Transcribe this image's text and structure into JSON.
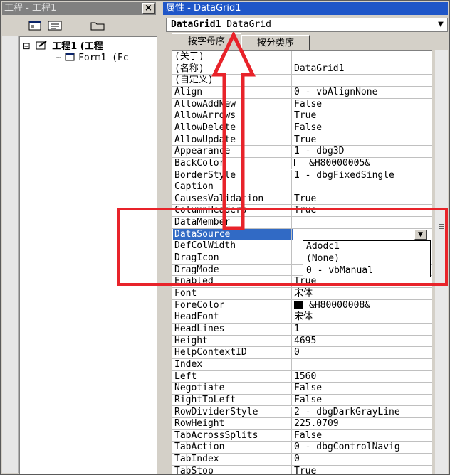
{
  "project_panel": {
    "title": "工程 - 工程1",
    "close_label": "×",
    "tree": {
      "expander": "⊟",
      "root_label": "工程1 (工程",
      "child_label": "Form1 (Fc"
    }
  },
  "properties_panel": {
    "title": "属性 - DataGrid1",
    "object_name": "DataGrid1",
    "object_type": "DataGrid",
    "tabs": [
      {
        "label": "按字母序"
      },
      {
        "label": "按分类序"
      }
    ],
    "rows": [
      {
        "name": "(关于)",
        "value": ""
      },
      {
        "name": "(名称)",
        "value": "DataGrid1"
      },
      {
        "name": "(自定义)",
        "value": ""
      },
      {
        "name": "Align",
        "value": "0 - vbAlignNone"
      },
      {
        "name": "AllowAddNew",
        "value": "False"
      },
      {
        "name": "AllowArrows",
        "value": "True"
      },
      {
        "name": "AllowDelete",
        "value": "False"
      },
      {
        "name": "AllowUpdate",
        "value": "True"
      },
      {
        "name": "Appearance",
        "value": "1 - dbg3D"
      },
      {
        "name": "BackColor",
        "value": "&H80000005&"
      },
      {
        "name": "BorderStyle",
        "value": "1 - dbgFixedSingle"
      },
      {
        "name": "Caption",
        "value": ""
      },
      {
        "name": "CausesValidation",
        "value": "True"
      },
      {
        "name": "ColumnHeaders",
        "value": "True"
      },
      {
        "name": "DataMember",
        "value": ""
      },
      {
        "name": "DataSource",
        "value": ""
      },
      {
        "name": "DefColWidth",
        "value": ""
      },
      {
        "name": "DragIcon",
        "value": ""
      },
      {
        "name": "DragMode",
        "value": ""
      },
      {
        "name": "Enabled",
        "value": "True"
      },
      {
        "name": "Font",
        "value": "宋体"
      },
      {
        "name": "ForeColor",
        "value": "&H80000008&"
      },
      {
        "name": "HeadFont",
        "value": "宋体"
      },
      {
        "name": "HeadLines",
        "value": "1"
      },
      {
        "name": "Height",
        "value": "4695"
      },
      {
        "name": "HelpContextID",
        "value": "0"
      },
      {
        "name": "Index",
        "value": ""
      },
      {
        "name": "Left",
        "value": "1560"
      },
      {
        "name": "Negotiate",
        "value": "False"
      },
      {
        "name": "RightToLeft",
        "value": "False"
      },
      {
        "name": "RowDividerStyle",
        "value": "2 - dbgDarkGrayLine"
      },
      {
        "name": "RowHeight",
        "value": "225.0709"
      },
      {
        "name": "TabAcrossSplits",
        "value": "False"
      },
      {
        "name": "TabAction",
        "value": "0 - dbgControlNavig"
      },
      {
        "name": "TabIndex",
        "value": "0"
      },
      {
        "name": "TabStop",
        "value": "True"
      }
    ],
    "datasource_options": [
      "Adodc1",
      "(None)",
      "0 - vbManual"
    ]
  },
  "colors": {
    "accent_title": "#1f56c8",
    "selection": "#316ac5",
    "annotation_red": "#e8232a"
  }
}
